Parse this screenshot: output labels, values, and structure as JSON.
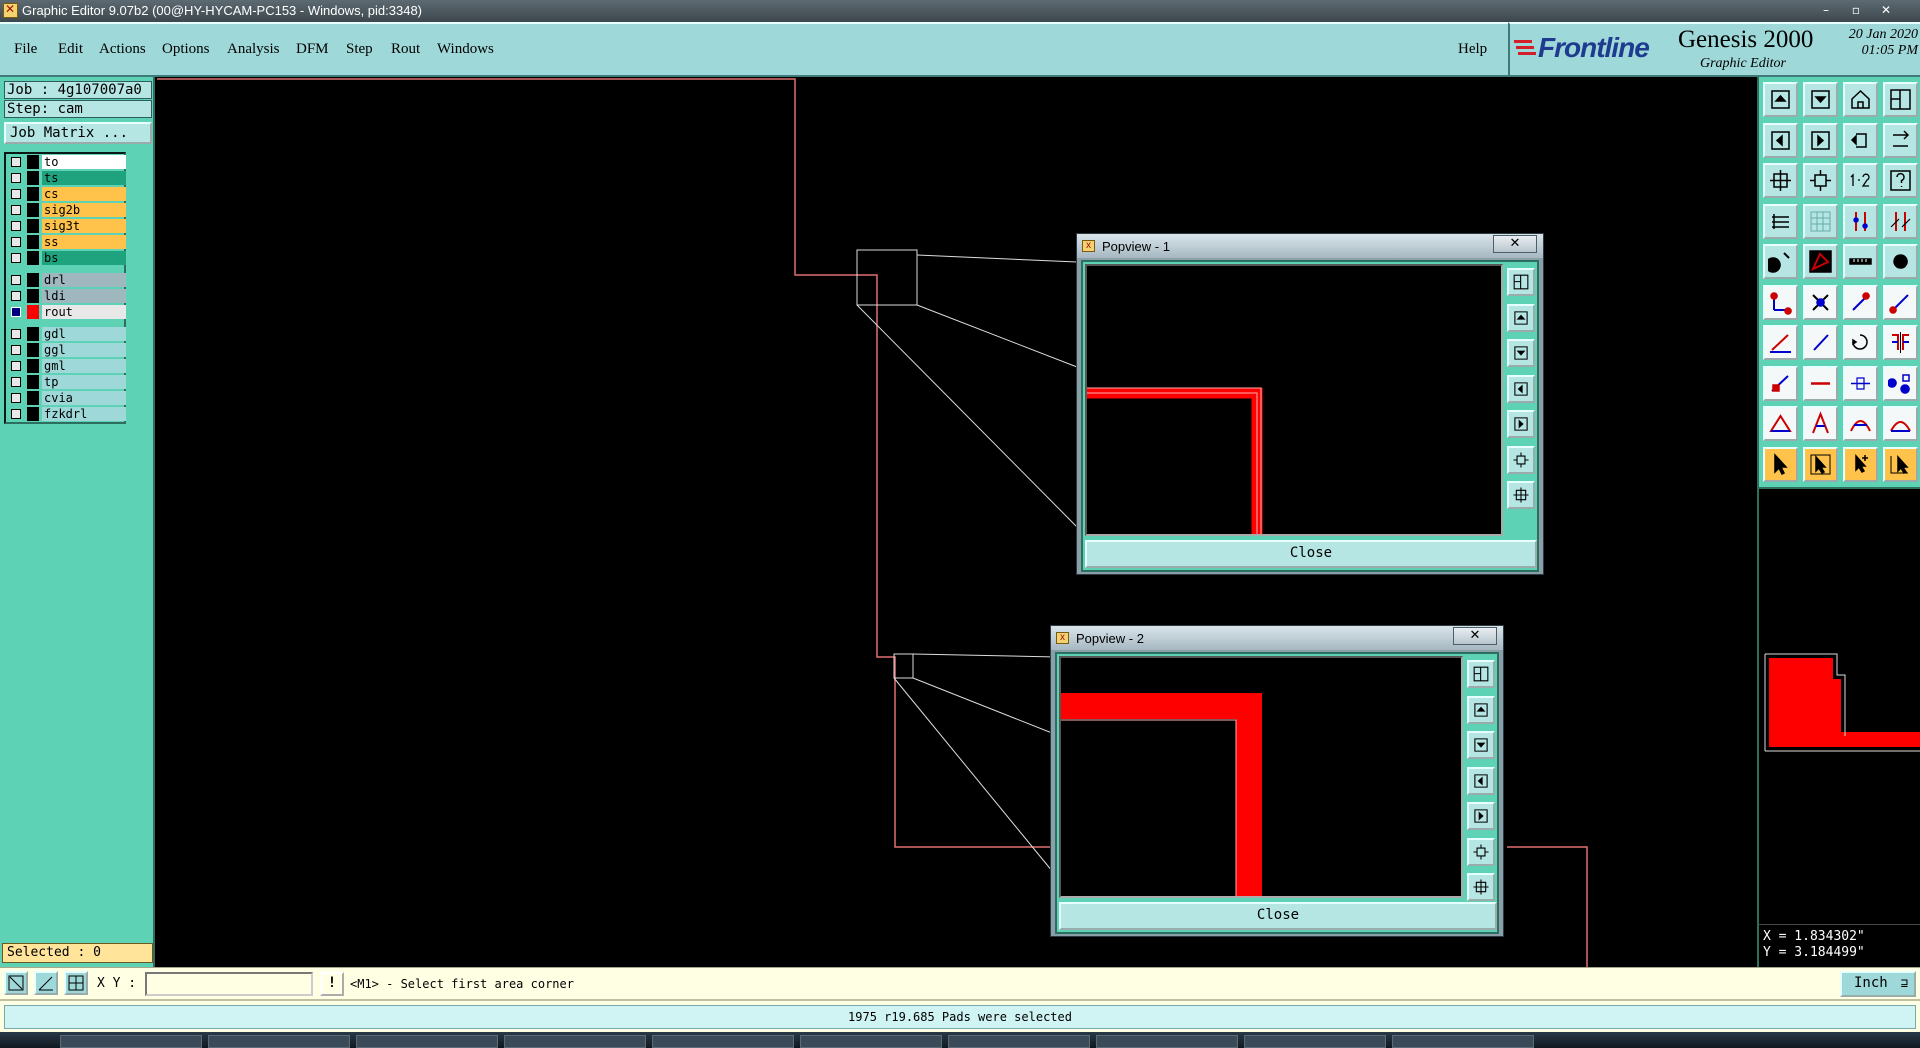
{
  "window": {
    "title": "Graphic Editor 9.07b2 (00@HY-HYCAM-PC153 - Windows, pid:3348)"
  },
  "menu": {
    "items": [
      "File",
      "Edit",
      "Actions",
      "Options",
      "Analysis",
      "DFM",
      "Step",
      "Rout",
      "Windows"
    ],
    "help": "Help"
  },
  "brand": {
    "logo": "Frontline",
    "product": "Genesis 2000",
    "subtitle": "Graphic Editor",
    "date": "20 Jan 2020",
    "time": "01:05 PM"
  },
  "job": {
    "job_label": "Job : 4g107007a0",
    "step_label": "Step: cam",
    "matrix_button": "Job Matrix ..."
  },
  "layers": [
    {
      "name": "to",
      "color": "#ffffff",
      "group": 1
    },
    {
      "name": "ts",
      "color": "#1fa37e",
      "group": 1
    },
    {
      "name": "cs",
      "color": "#ffc24a",
      "group": 1
    },
    {
      "name": "sig2b",
      "color": "#ffc24a",
      "group": 1
    },
    {
      "name": "sig3t",
      "color": "#ffc24a",
      "group": 1
    },
    {
      "name": "ss",
      "color": "#ffc24a",
      "group": 1
    },
    {
      "name": "bs",
      "color": "#1fa37e",
      "group": 1
    },
    {
      "name": "drl",
      "color": "#9fb8c0",
      "group": 2
    },
    {
      "name": "ldi",
      "color": "#9fb8c0",
      "group": 2
    },
    {
      "name": "rout",
      "color": "#e8e8e8",
      "group": 2,
      "active": true
    },
    {
      "name": "gdl",
      "color": "#9fd8d8",
      "group": 3
    },
    {
      "name": "ggl",
      "color": "#9fd8d8",
      "group": 3
    },
    {
      "name": "gml",
      "color": "#9fd8d8",
      "group": 3
    },
    {
      "name": "tp",
      "color": "#9fd8d8",
      "group": 3
    },
    {
      "name": "cvia",
      "color": "#9fd8d8",
      "group": 3
    },
    {
      "name": "fzkdrl",
      "color": "#9fd8d8",
      "group": 3
    }
  ],
  "selected": "Selected : 0",
  "popview1": {
    "title": "Popview - 1",
    "close": "Close",
    "close_x": "✕"
  },
  "popview2": {
    "title": "Popview - 2",
    "close": "Close",
    "close_x": "✕"
  },
  "coords": {
    "x": "X = 1.834302\"",
    "y": "Y = 3.184499\""
  },
  "command": {
    "xy_label": "X Y :",
    "xy_value": "",
    "excl": "!",
    "prompt": "<M1> - Select first area corner",
    "units": "Inch"
  },
  "status": "1975 r19.685 Pads were selected",
  "colors": {
    "teal": "#5ed2b4",
    "light_teal": "#9fd8d8",
    "rout_red": "#ff0000",
    "outline": "#e07070"
  },
  "toolbox_icons": [
    "page-up-icon",
    "page-down-icon",
    "home-icon",
    "split-icon",
    "page-left-icon",
    "page-right-icon",
    "undo-icon",
    "redo-icon",
    "fit-icon",
    "zoom-fit-icon",
    "scale-icon",
    "query-icon",
    "snap-icon",
    "grid-icon",
    "layer-up-icon",
    "layer-down-icon",
    "pad-icon",
    "surface-icon",
    "measure-icon",
    "dot-icon",
    "net-icon",
    "cross-icon",
    "line-icon",
    "connect-icon",
    "draw-line-icon",
    "slash-icon",
    "arc-icon",
    "mirror-icon",
    "move-icon",
    "line-h-icon",
    "stretch-icon",
    "copy-icon",
    "triangle-icon",
    "triangle-alt-icon",
    "arch-icon",
    "arch-alt-icon",
    "pointer-icon",
    "pointer-box-icon",
    "pointer-plus-icon",
    "pointer-route-icon"
  ]
}
